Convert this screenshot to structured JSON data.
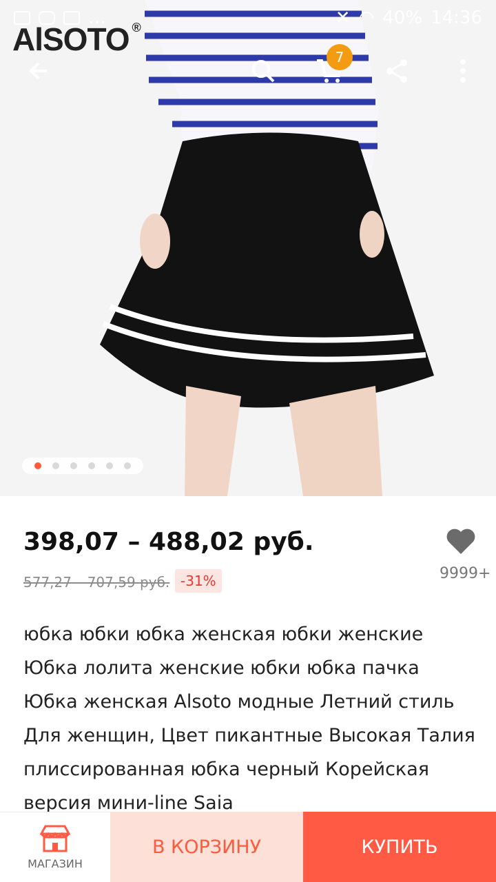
{
  "status_bar": {
    "battery": "40%",
    "time": "14:36"
  },
  "brand": {
    "logo_text": "AlSOTO",
    "reg": "®"
  },
  "header": {
    "cart_badge": "7"
  },
  "gallery": {
    "slides": 6,
    "active": 0
  },
  "product": {
    "price": "398,07 – 488,02 руб.",
    "old_price": "577,27 – 707,59 руб.",
    "discount": "-31%",
    "favorites_count": "9999+",
    "title": "юбка юбки юбка женская юбки женские Юбка лолита женские юбки юбка пачка Юбка женская Alsoto модные Летний стиль Для женщин, Цвет пикантные Высокая Талия плиссированная юбка черный Корейская версия мини-line Saia"
  },
  "actions": {
    "shop_label": "МАГАЗИН",
    "cart_label": "В КОРЗИНУ",
    "buy_label": "КУПИТЬ"
  },
  "colors": {
    "accent": "#ff5a44",
    "cart_bg": "#fde0d8",
    "badge": "#f39c12"
  },
  "icons": [
    "back-arrow-icon",
    "search-icon",
    "cart-icon",
    "share-icon",
    "more-vert-icon",
    "heart-icon",
    "store-icon"
  ]
}
